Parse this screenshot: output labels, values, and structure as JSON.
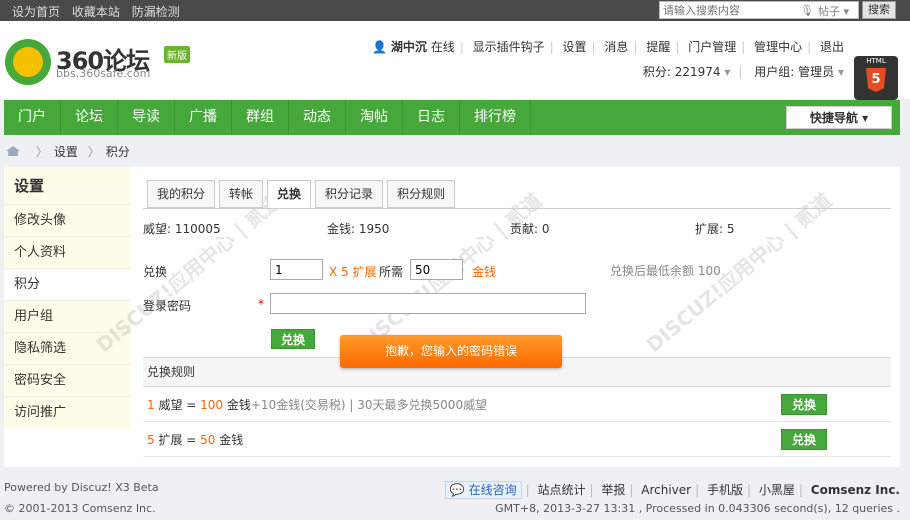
{
  "topbar": {
    "links": [
      "设为首页",
      "收藏本站",
      "防漏检测"
    ],
    "search_placeholder": "请输入搜索内容",
    "search_type": "帖子",
    "search_button": "搜索"
  },
  "logo": {
    "name": "360论坛",
    "badge": "新版",
    "url": "bbs.360safe.com"
  },
  "user": {
    "name": "湖中沉",
    "status": "在线",
    "links": [
      "显示插件钩子",
      "设置",
      "消息",
      "提醒",
      "门户管理",
      "管理中心",
      "退出"
    ],
    "points_label": "积分: 221974",
    "group_label": "用户组: 管理员"
  },
  "html5_label": "HTML",
  "nav": {
    "items": [
      "门户",
      "论坛",
      "导读",
      "广播",
      "群组",
      "动态",
      "淘帖",
      "日志",
      "排行榜"
    ],
    "quick": "快捷导航"
  },
  "breadcrumb": [
    "设置",
    "积分"
  ],
  "sidebar": {
    "title": "设置",
    "items": [
      "修改头像",
      "个人资料",
      "积分",
      "用户组",
      "隐私筛选",
      "密码安全",
      "访问推广"
    ]
  },
  "tabs": [
    "我的积分",
    "转帐",
    "兑换",
    "积分记录",
    "积分规则"
  ],
  "stats": {
    "weiwang": "威望: 110005",
    "jinqian": "金钱: 1950",
    "gongxian": "贡献: 0",
    "kuozhan": "扩展: 5"
  },
  "exchange": {
    "label": "兑换",
    "amount": "1",
    "unit": "X 5 扩展",
    "need_label": "所需",
    "need_value": "50",
    "currency": "金钱",
    "min_balance": "兑换后最低余额 100",
    "password_label": "登录密码",
    "required": "*",
    "submit": "兑换"
  },
  "toast": "抱歉，您输入的密码错误",
  "rules": {
    "head": "兑换规则",
    "r1_a": "1",
    "r1_b": " 威望 = ",
    "r1_c": "100",
    "r1_d": " 金钱",
    "r1_e": "+10金钱(交易税)",
    "r1_f": "| 30天最多兑换5000威望",
    "r2_a": "5",
    "r2_b": " 扩展 = ",
    "r2_c": "50",
    "r2_d": " 金钱",
    "button": "兑换"
  },
  "footer": {
    "powered": "Powered by Discuz! X3 Beta",
    "copyright": "© 2001-2013 Comsenz Inc.",
    "kf": "在线咨询",
    "links": [
      "站点统计",
      "举报",
      "Archiver",
      "手机版",
      "小黑屋",
      "Comsenz Inc."
    ],
    "info": "GMT+8, 2013-3-27 13:31 , Processed in 0.043306 second(s), 12 queries ."
  }
}
